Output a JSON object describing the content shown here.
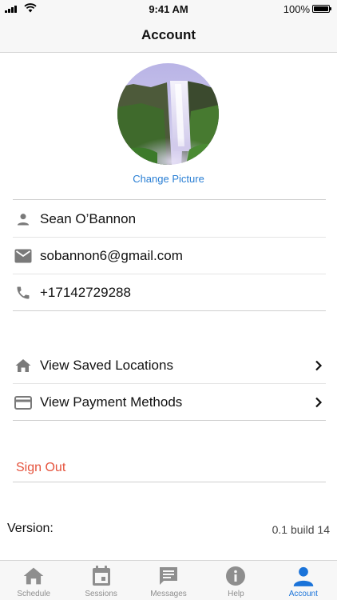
{
  "status_bar": {
    "time": "9:41 AM",
    "battery": "100%"
  },
  "nav": {
    "title": "Account"
  },
  "profile": {
    "change_picture": "Change Picture"
  },
  "info_rows": [
    {
      "icon": "person-icon",
      "text": "Sean O’Bannon"
    },
    {
      "icon": "mail-icon",
      "text": "sobannon6@gmail.com"
    },
    {
      "icon": "phone-icon",
      "text": "+17142729288"
    }
  ],
  "nav_rows": [
    {
      "icon": "home-icon",
      "text": "View Saved Locations"
    },
    {
      "icon": "credit-card-icon",
      "text": "View Payment Methods"
    }
  ],
  "sign_out": "Sign Out",
  "version": {
    "label": "Version:",
    "value": "0.1 build 14"
  },
  "tabs": [
    {
      "label": "Schedule",
      "icon": "home-icon"
    },
    {
      "label": "Sessions",
      "icon": "calendar-icon"
    },
    {
      "label": "Messages",
      "icon": "message-icon"
    },
    {
      "label": "Help",
      "icon": "info-icon"
    },
    {
      "label": "Account",
      "icon": "person-icon",
      "active": true
    }
  ],
  "colors": {
    "accent": "#1a73d9",
    "link": "#2a7fd4",
    "danger": "#e5533d",
    "inactive_tab": "#8e8e8e",
    "row_icon": "#7a7a7a"
  }
}
